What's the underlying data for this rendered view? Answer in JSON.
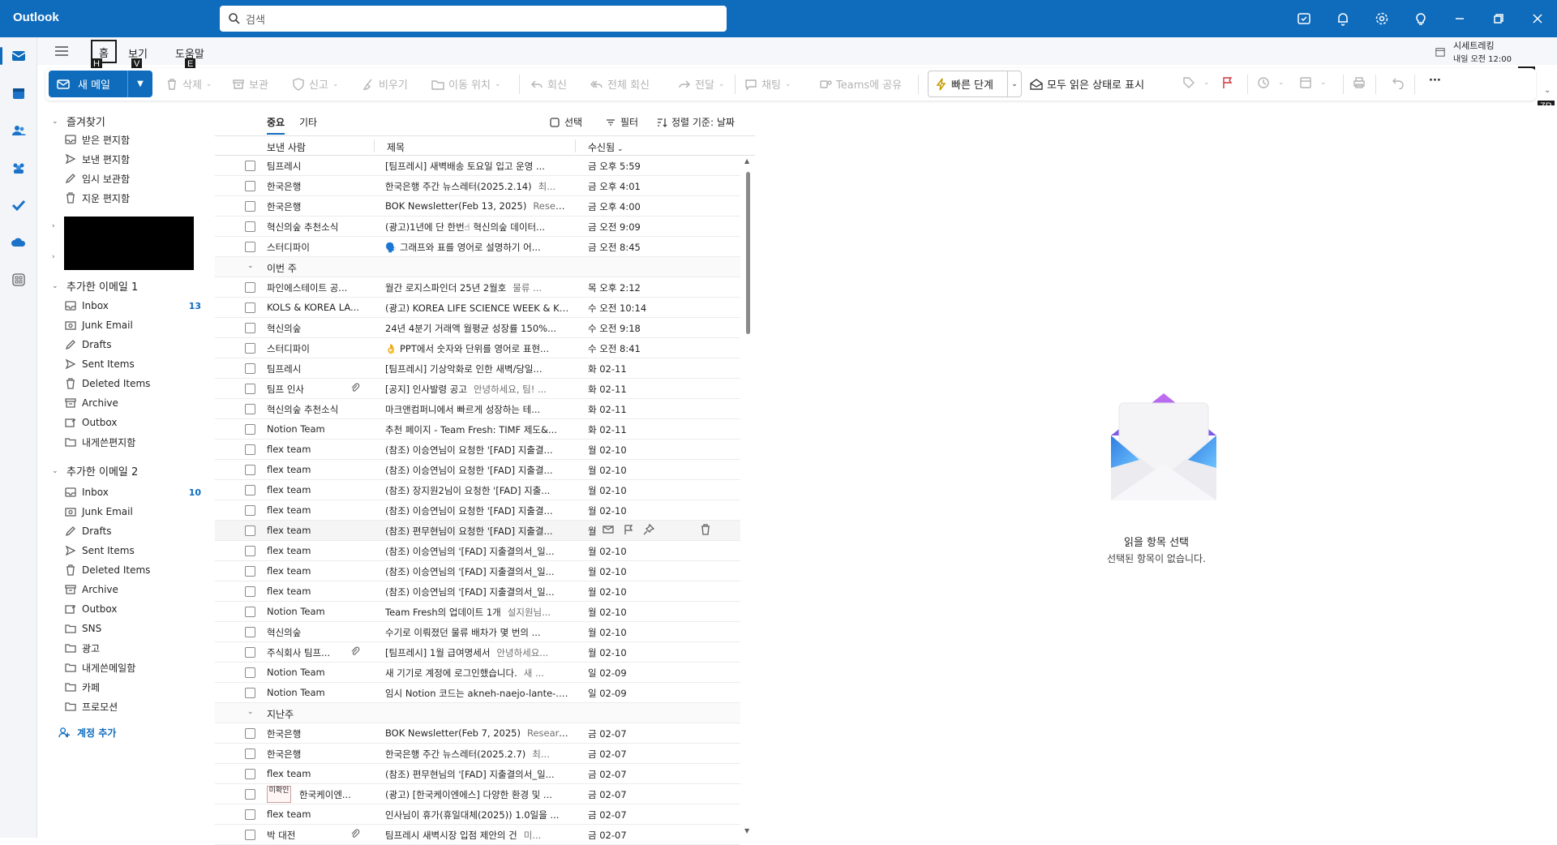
{
  "app": {
    "title": "Outlook"
  },
  "search": {
    "placeholder": "검색"
  },
  "tabs": {
    "items": [
      {
        "label": "홈",
        "keytip": "H"
      },
      {
        "label": "보기",
        "keytip": "V"
      },
      {
        "label": "도움말",
        "keytip": "E"
      }
    ]
  },
  "schedule": {
    "title": "시세트레킹",
    "time": "내일 오전 12:00",
    "keytip": "TU",
    "keytip2": "ZR"
  },
  "ribbon": {
    "new_mail": "새 메일",
    "delete": "삭제",
    "archive": "보관",
    "report": "신고",
    "sweep": "비우기",
    "move": "이동 위치",
    "reply": "회신",
    "reply_all": "전체 회신",
    "forward": "전달",
    "chat": "채팅",
    "teams": "Teams에 공유",
    "quick_steps": "빠른 단계",
    "mark_all_read": "모두 읽은 상태로 표시",
    "more": "···"
  },
  "folders": {
    "favorites": {
      "label": "즐겨찾기",
      "items": [
        "받은 편지함",
        "보낸 편지함",
        "임시 보관함",
        "지운 편지함"
      ]
    },
    "account1": {
      "label": "추가한 이메일 1",
      "items": [
        {
          "name": "Inbox",
          "count": "13"
        },
        {
          "name": "Junk Email",
          "count": ""
        },
        {
          "name": "Drafts",
          "count": ""
        },
        {
          "name": "Sent Items",
          "count": ""
        },
        {
          "name": "Deleted Items",
          "count": ""
        },
        {
          "name": "Archive",
          "count": ""
        },
        {
          "name": "Outbox",
          "count": ""
        },
        {
          "name": "내게쓴편지함",
          "count": ""
        }
      ]
    },
    "account2": {
      "label": "추가한 이메일 2",
      "items": [
        {
          "name": "Inbox",
          "count": "10"
        },
        {
          "name": "Junk Email",
          "count": ""
        },
        {
          "name": "Drafts",
          "count": ""
        },
        {
          "name": "Sent Items",
          "count": ""
        },
        {
          "name": "Deleted Items",
          "count": ""
        },
        {
          "name": "Archive",
          "count": ""
        },
        {
          "name": "Outbox",
          "count": ""
        },
        {
          "name": "SNS",
          "count": ""
        },
        {
          "name": "광고",
          "count": ""
        },
        {
          "name": "내게쓴메일함",
          "count": ""
        },
        {
          "name": "카페",
          "count": ""
        },
        {
          "name": "프로모션",
          "count": ""
        }
      ]
    },
    "add_account": "계정 추가"
  },
  "list": {
    "tab_focused": "중요",
    "tab_other": "기타",
    "select": "선택",
    "filter": "필터",
    "sort": "정렬 기준: 날짜",
    "col_from": "보낸 사람",
    "col_subject": "제목",
    "col_received": "수신됨",
    "groups": {
      "this_week": "이번 주",
      "last_week": "지난주"
    },
    "rows_top": [
      {
        "from": "팀프레시",
        "subject": "[팀프레시] 새벽배송 토요일 입고 운영 ...",
        "preview": "",
        "date": "금 오후 5:59"
      },
      {
        "from": "한국은행",
        "subject": "한국은행 주간 뉴스레터(2025.2.14)",
        "preview": "최...",
        "date": "금 오후 4:01"
      },
      {
        "from": "한국은행",
        "subject": "BOK Newsletter(Feb 13, 2025)",
        "preview": "Researc...",
        "date": "금 오후 4:00"
      },
      {
        "from": "혁신의숲 추천소식",
        "subject": "(광고)1년에 단 한번☝ 혁신의숲 데이터...",
        "preview": "",
        "date": "금 오전 9:09"
      },
      {
        "from": "스터디파이",
        "subject": "🗣️ 그래프와 표를 영어로 설명하기 어...",
        "preview": "",
        "date": "금 오전 8:45"
      }
    ],
    "rows_week": [
      {
        "from": "파인에스테이트 공...",
        "subject": "월간 로지스파인더 25년 2월호",
        "preview": "물류 ...",
        "date": "목 오후 2:12"
      },
      {
        "from": "KOLS & KOREA LA...",
        "subject": "(광고) KOREA LIFE SCIENCE WEEK & K...",
        "preview": "",
        "date": "수 오전 10:14"
      },
      {
        "from": "혁신의숲",
        "subject": "24년 4분기 거래액 월평균 성장률 150%...",
        "preview": "",
        "date": "수 오전 9:18"
      },
      {
        "from": "스터디파이",
        "subject": "👌 PPT에서 숫자와 단위를 영어로 표현...",
        "preview": "",
        "date": "수 오전 8:41"
      },
      {
        "from": "팀프레시",
        "subject": "[팀프레시] 기상악화로 인한 새벽/당일...",
        "preview": "",
        "date": "화 02-11"
      },
      {
        "from": "팀프 인사",
        "subject": "[공지] 인사발령 공고",
        "preview": "안녕하세요, 팀! ...",
        "date": "화 02-11",
        "attach": true
      },
      {
        "from": "혁신의숲 추천소식",
        "subject": "마크앤컴퍼니에서 빠르게 성장하는 테...",
        "preview": "",
        "date": "화 02-11"
      },
      {
        "from": "Notion Team",
        "subject": "추천 페이지 - Team Fresh: TIMF 제도&...",
        "preview": "",
        "date": "화 02-11"
      },
      {
        "from": "flex team",
        "subject": "(참조) 이승연님이 요청한 '[FAD] 지출결...",
        "preview": "",
        "date": "월 02-10"
      },
      {
        "from": "flex team",
        "subject": "(참조) 이승연님이 요청한 '[FAD] 지출결...",
        "preview": "",
        "date": "월 02-10"
      },
      {
        "from": "flex team",
        "subject": "(참조) 장지원2님이 요청한 '[FAD] 지출...",
        "preview": "",
        "date": "월 02-10"
      },
      {
        "from": "flex team",
        "subject": "(참조) 이승연님이 요청한 '[FAD] 지출결...",
        "preview": "",
        "date": "월 02-10"
      },
      {
        "from": "flex team",
        "subject": "(참조) 편무현님이 요청한 '[FAD] 지출결...",
        "preview": "",
        "date": "월",
        "hover": true
      },
      {
        "from": "flex team",
        "subject": "(참조) 이승연님의 '[FAD] 지출결의서_일...",
        "preview": "",
        "date": "월 02-10"
      },
      {
        "from": "flex team",
        "subject": "(참조) 이승연님의 '[FAD] 지출결의서_일...",
        "preview": "",
        "date": "월 02-10"
      },
      {
        "from": "flex team",
        "subject": "(참조) 이승연님의 '[FAD] 지출결의서_일...",
        "preview": "",
        "date": "월 02-10"
      },
      {
        "from": "Notion Team",
        "subject": "Team Fresh의 업데이트 1개",
        "preview": "설지원님...",
        "date": "월 02-10"
      },
      {
        "from": "혁신의숲",
        "subject": "수기로 이뤄졌던 물류 배차가 몇 번의 ...",
        "preview": "",
        "date": "월 02-10"
      },
      {
        "from": "주식회사 팀프...",
        "subject": "[팀프레시] 1월 급여명세서",
        "preview": "안녕하세요...",
        "date": "월 02-10",
        "attach": true
      },
      {
        "from": "Notion Team",
        "subject": "새 기기로 계정에 로그인했습니다.",
        "preview": "새 ...",
        "date": "일 02-09"
      },
      {
        "from": "Notion Team",
        "subject": "임시 Notion 코드는 akneh-naejo-lante-...",
        "preview": "",
        "date": "일 02-09"
      }
    ],
    "rows_last": [
      {
        "from": "한국은행",
        "subject": "BOK Newsletter(Feb 7, 2025)",
        "preview": "Researc...",
        "date": "금 02-07"
      },
      {
        "from": "한국은행",
        "subject": "한국은행 주간 뉴스레터(2025.2.7)",
        "preview": "최...",
        "date": "금 02-07"
      },
      {
        "from": "flex team",
        "subject": "(참조) 편무현님의 '[FAD] 지출결의서_일...",
        "preview": "",
        "date": "금 02-07"
      },
      {
        "from": "한국케이엔...",
        "subject": "(광고) [한국케이엔에스] 다양한 환경 및 ...",
        "preview": "",
        "date": "금 02-07",
        "avatar": "미확인"
      },
      {
        "from": "flex team",
        "subject": "인사님이 휴가(휴일대체(2025)) 1.0일을 ...",
        "preview": "",
        "date": "금 02-07"
      },
      {
        "from": "박 대전",
        "subject": "팀프레시 새벽시장 입점 제안의 건",
        "preview": "미...",
        "date": "금 02-07",
        "attach": true
      }
    ]
  },
  "reading": {
    "title": "읽을 항목 선택",
    "subtitle": "선택된 항목이 없습니다."
  }
}
